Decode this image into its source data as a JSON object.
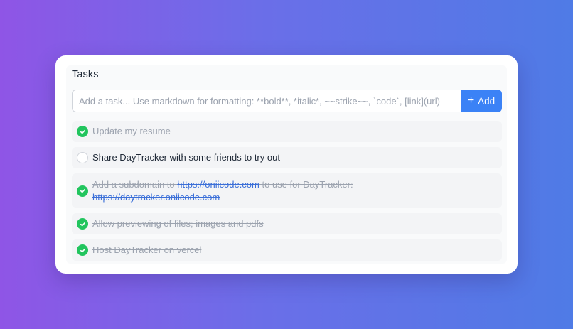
{
  "header": {
    "title": "Tasks"
  },
  "input": {
    "placeholder": "Add a task... Use markdown for formatting: **bold**, *italic*, ~~strike~~, `code`, [link](url)",
    "value": ""
  },
  "add_button": {
    "icon": "+",
    "label": "Add"
  },
  "colors": {
    "accent": "#3b82f6",
    "done": "#22c55e",
    "link": "#3b6fd8"
  },
  "tasks": [
    {
      "text": "Update my resume",
      "done": true
    },
    {
      "text": "Share DayTracker with some friends to try out",
      "done": false
    },
    {
      "done": true,
      "parts": [
        {
          "text": "Add a subdomain to "
        },
        {
          "text": "https://oniicode.com",
          "link": true
        },
        {
          "text": " to use for DayTracker: "
        },
        {
          "text": "https://daytracker.oniicode.com",
          "link": true
        }
      ]
    },
    {
      "text": "Allow previewing of files; images and pdfs",
      "done": true
    },
    {
      "text": "Host DayTracker on vercel",
      "done": true
    }
  ]
}
